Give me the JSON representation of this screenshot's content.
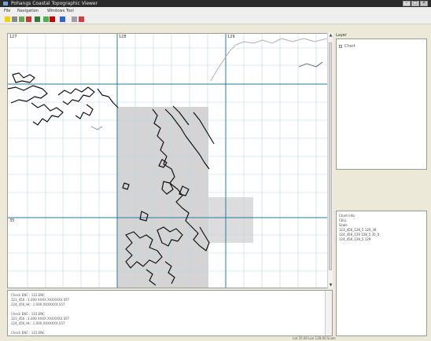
{
  "window": {
    "title": "Pohangs Coastal Topographic Viewer",
    "minimize_symbol": "–",
    "maximize_symbol": "□",
    "close_symbol": "×"
  },
  "menu": [
    "File",
    "Navigation",
    "Windows",
    "Tool"
  ],
  "toolbar": {
    "buttons": [
      {
        "name": "tool-yellow",
        "color": "#f0d000"
      },
      {
        "name": "tool-pan",
        "color": "#8a8a8a"
      },
      {
        "name": "tool-green",
        "color": "#6aa84f"
      },
      {
        "name": "tool-red",
        "color": "#cc3333"
      },
      {
        "name": "tool-dark-green",
        "color": "#2f7d32"
      },
      {
        "name": "tool-green-2",
        "color": "#4caf50"
      },
      {
        "name": "tool-stop",
        "color": "#cc0000"
      },
      {
        "name": "tool-blue",
        "color": "#3366cc"
      },
      {
        "name": "tool-gray",
        "color": "#a0a0a0"
      },
      {
        "name": "tool-red-2",
        "color": "#d04040"
      }
    ]
  },
  "map": {
    "grid_labels": {
      "top_left": "127",
      "top_middle": "128",
      "top_right": "129",
      "left_lower": "35"
    },
    "colors": {
      "grid": "#2a7a9e",
      "fine_grid": "#b9d8e4",
      "coastline": "#111111",
      "shade": "#d2d2d2"
    }
  },
  "console": {
    "lines": [
      "Check ENC : 123.ENC",
      "123_456 : 1.000 XXXX XXXXXXX.S57",
      "124_456_Ht : 1.000 XXXXXXX.S57",
      "",
      "Check ENC : 123.ENC",
      "123_456 : 1.000 XXXX XXXXXXX.S57",
      "124_456_Ht : 1.000 XXXXXXX.S57",
      "",
      "Check ENC : 123.ENC"
    ]
  },
  "right_panel": {
    "title": "Layer",
    "tree_item": "Chart"
  },
  "properties": {
    "lines": [
      "Chart info",
      "CELL",
      "Scale",
      "123_456_128_5 129_36",
      "124_456_129 128_5 35_5",
      "124_456_128_5 129"
    ]
  },
  "status": {
    "text": "Lat 35.00 Lon 128.00 Scale"
  }
}
